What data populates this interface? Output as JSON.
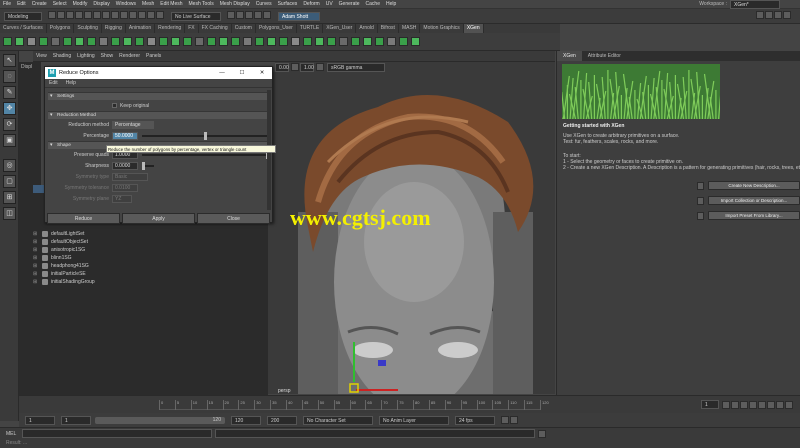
{
  "menubar": {
    "items": [
      "File",
      "Edit",
      "Create",
      "Select",
      "Modify",
      "Display",
      "Windows",
      "Mesh",
      "Edit Mesh",
      "Mesh Tools",
      "Mesh Display",
      "Curves",
      "Surfaces",
      "Deform",
      "UV",
      "Generate",
      "Cache",
      "Help"
    ],
    "workspace_label": "Workspace :",
    "workspace_value": "XGen*"
  },
  "status": {
    "mode": "Modeling",
    "live_surface": "No Live Surface",
    "user": "Adam Shott"
  },
  "shelf": {
    "tabs": [
      "Curves / Surfaces",
      "Polygons",
      "Sculpting",
      "Rigging",
      "Animation",
      "Rendering",
      "FX",
      "FX Caching",
      "Custom",
      "Polygons_User",
      "TURTLE",
      "XGen_User",
      "Arnold",
      "Bifrost",
      "MASH",
      "Motion Graphics",
      "XGen"
    ],
    "active_tab": "XGen"
  },
  "viewport": {
    "menus": [
      "View",
      "Shading",
      "Lighting",
      "Show",
      "Renderer",
      "Panels"
    ],
    "field_a": "0.00",
    "field_b": "1.00",
    "color_space": "sRGB gamma",
    "camera": "persp"
  },
  "dialog": {
    "title": "Reduce Options",
    "menus": [
      "Edit",
      "Help"
    ],
    "settings_section": "Settings",
    "keep_original": "Keep original",
    "method_section": "Reduction Method",
    "reduction_method_label": "Reduction method",
    "reduction_method_value": "Percentage",
    "percentage_label": "Percentage",
    "percentage_value": "50.0000",
    "shape_section": "Shape",
    "preserve_quads_label": "Preserve quads",
    "preserve_quads_value": "1.0000",
    "sharpness_label": "Sharpness",
    "sharpness_value": "0.0000",
    "symmetry_type_label": "Symmetry type",
    "symmetry_type_value": "Basic",
    "symmetry_tolerance_label": "Symmetry tolerance",
    "symmetry_tolerance_value": "0.0100",
    "symmetry_plane_label": "Symmetry plane",
    "symmetry_plane_value": "YZ",
    "reduce_button": "Reduce",
    "apply_button": "Apply",
    "close_button": "Close"
  },
  "tooltip": "Reduce the number of polygons by percentage, vertex or triangle count",
  "outliner": {
    "panel_label": "Displ",
    "items": [
      "defaultLightSet",
      "defaultObjectSet",
      "anisotropic1SG",
      "blinn1SG",
      "headphong41SG",
      "initialParticleSE",
      "initialShadingGroup"
    ]
  },
  "xgen": {
    "tabs": [
      "XGen",
      "Attribute Editor"
    ],
    "heading": "Getting started with XGen",
    "intro": "Use XGen to create arbitrary primitives on a surface.",
    "intro2": "Test: fur, feathers, scales, rocks, and more.",
    "start_label": "To start:",
    "step1": "1 - Select the geometry or faces to create primitive on.",
    "step2": "2 - Create a new XGen Description. A Description is a pattern for generating primitives (hair, rocks, trees, etc)",
    "btn_create": "Create New Description...",
    "btn_import": "Import Collection or Description...",
    "btn_preset": "Import Preset From Library..."
  },
  "timeline": {
    "ticks": [
      "0",
      "5",
      "10",
      "15",
      "20",
      "25",
      "30",
      "35",
      "40",
      "45",
      "50",
      "55",
      "60",
      "65",
      "70",
      "75",
      "80",
      "85",
      "90",
      "95",
      "100",
      "105",
      "110",
      "115",
      "120"
    ],
    "current": "1"
  },
  "range": {
    "start": "1",
    "start2": "1",
    "end": "120",
    "end2": "120",
    "end3": "200",
    "char_set": "No Character Set",
    "anim_layer": "No Anim Layer",
    "fps": "24 fps"
  },
  "cmd": {
    "lang": "MEL",
    "help": "Result: ..."
  },
  "watermark": "www.cgtsj.com",
  "colors": {
    "accent": "#5285a6",
    "xgen_green": "#35a34a",
    "watermark": "#f4f000"
  }
}
